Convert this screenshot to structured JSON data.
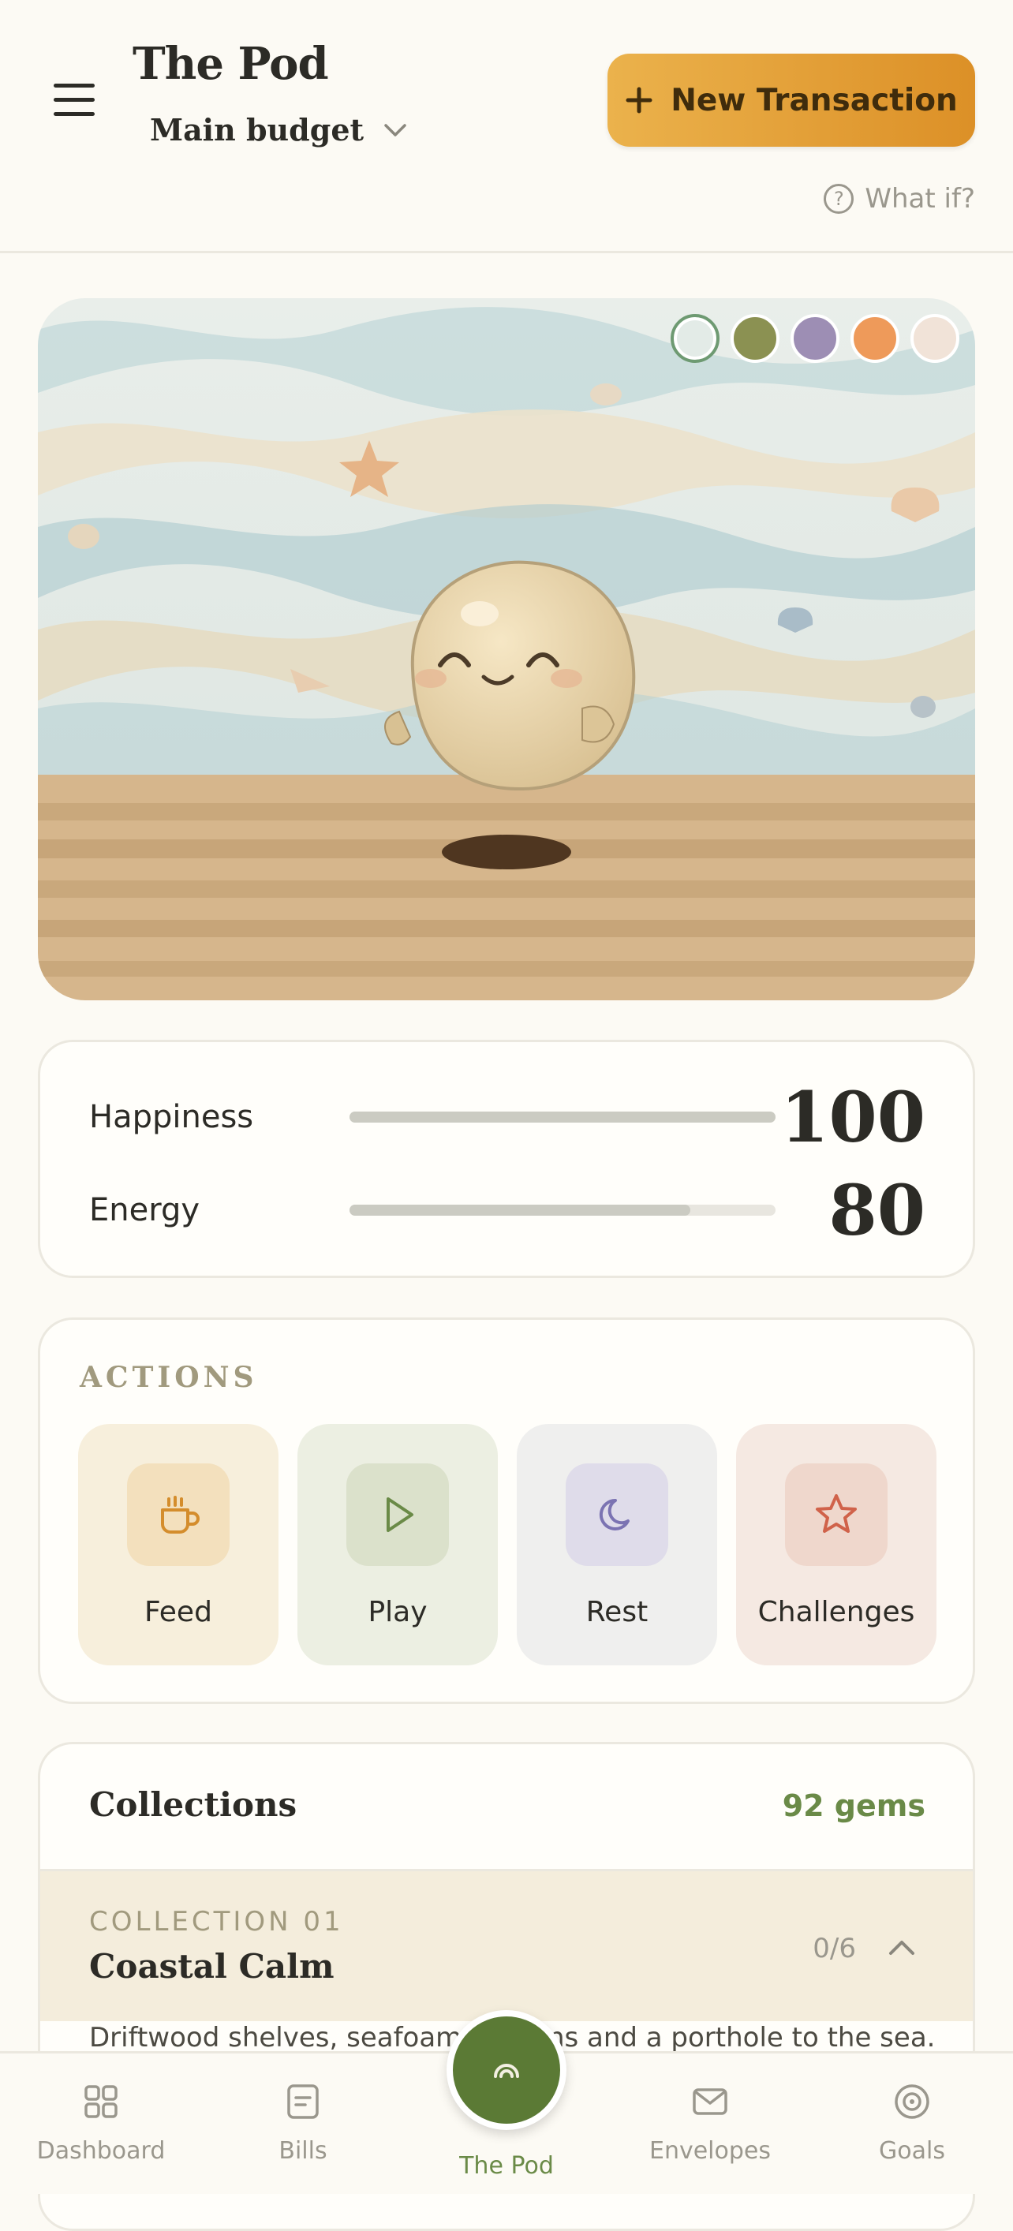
{
  "header": {
    "title": "The Pod",
    "budget": "Main budget",
    "new_transaction": "New Transaction",
    "what_if": "What if?"
  },
  "scene": {
    "theme_swatches": [
      {
        "name": "seafoam",
        "color": "#e3ebe7",
        "active": true
      },
      {
        "name": "moss",
        "color": "#8b9152",
        "active": false
      },
      {
        "name": "lavender",
        "color": "#9d8eb4",
        "active": false
      },
      {
        "name": "sunset",
        "color": "#ee9a5a",
        "active": false
      },
      {
        "name": "sand",
        "color": "#f1e3d8",
        "active": false
      }
    ]
  },
  "stats": [
    {
      "label": "Happiness",
      "value": "100",
      "fraction": 1.0
    },
    {
      "label": "Energy",
      "value": "80",
      "fraction": 0.8
    }
  ],
  "actions": {
    "title": "ACTIONS",
    "items": [
      {
        "label": "Feed",
        "icon": "cup-icon"
      },
      {
        "label": "Play",
        "icon": "play-icon"
      },
      {
        "label": "Rest",
        "icon": "moon-icon"
      },
      {
        "label": "Challenges",
        "icon": "star-icon"
      }
    ]
  },
  "collections": {
    "title": "Collections",
    "gems": "92 gems",
    "current": {
      "kicker": "COLLECTION 01",
      "name": "Coastal Calm",
      "count": "0/6",
      "description": "Driftwood shelves, seafoam curtains and a porthole to the sea."
    }
  },
  "nav": {
    "dashboard": "Dashboard",
    "bills": "Bills",
    "pod": "The Pod",
    "envelopes": "Envelopes",
    "goals": "Goals"
  },
  "colors": {
    "accent": "#dc9027",
    "primary_green": "#5b7a35",
    "background": "#fcfaf4"
  }
}
